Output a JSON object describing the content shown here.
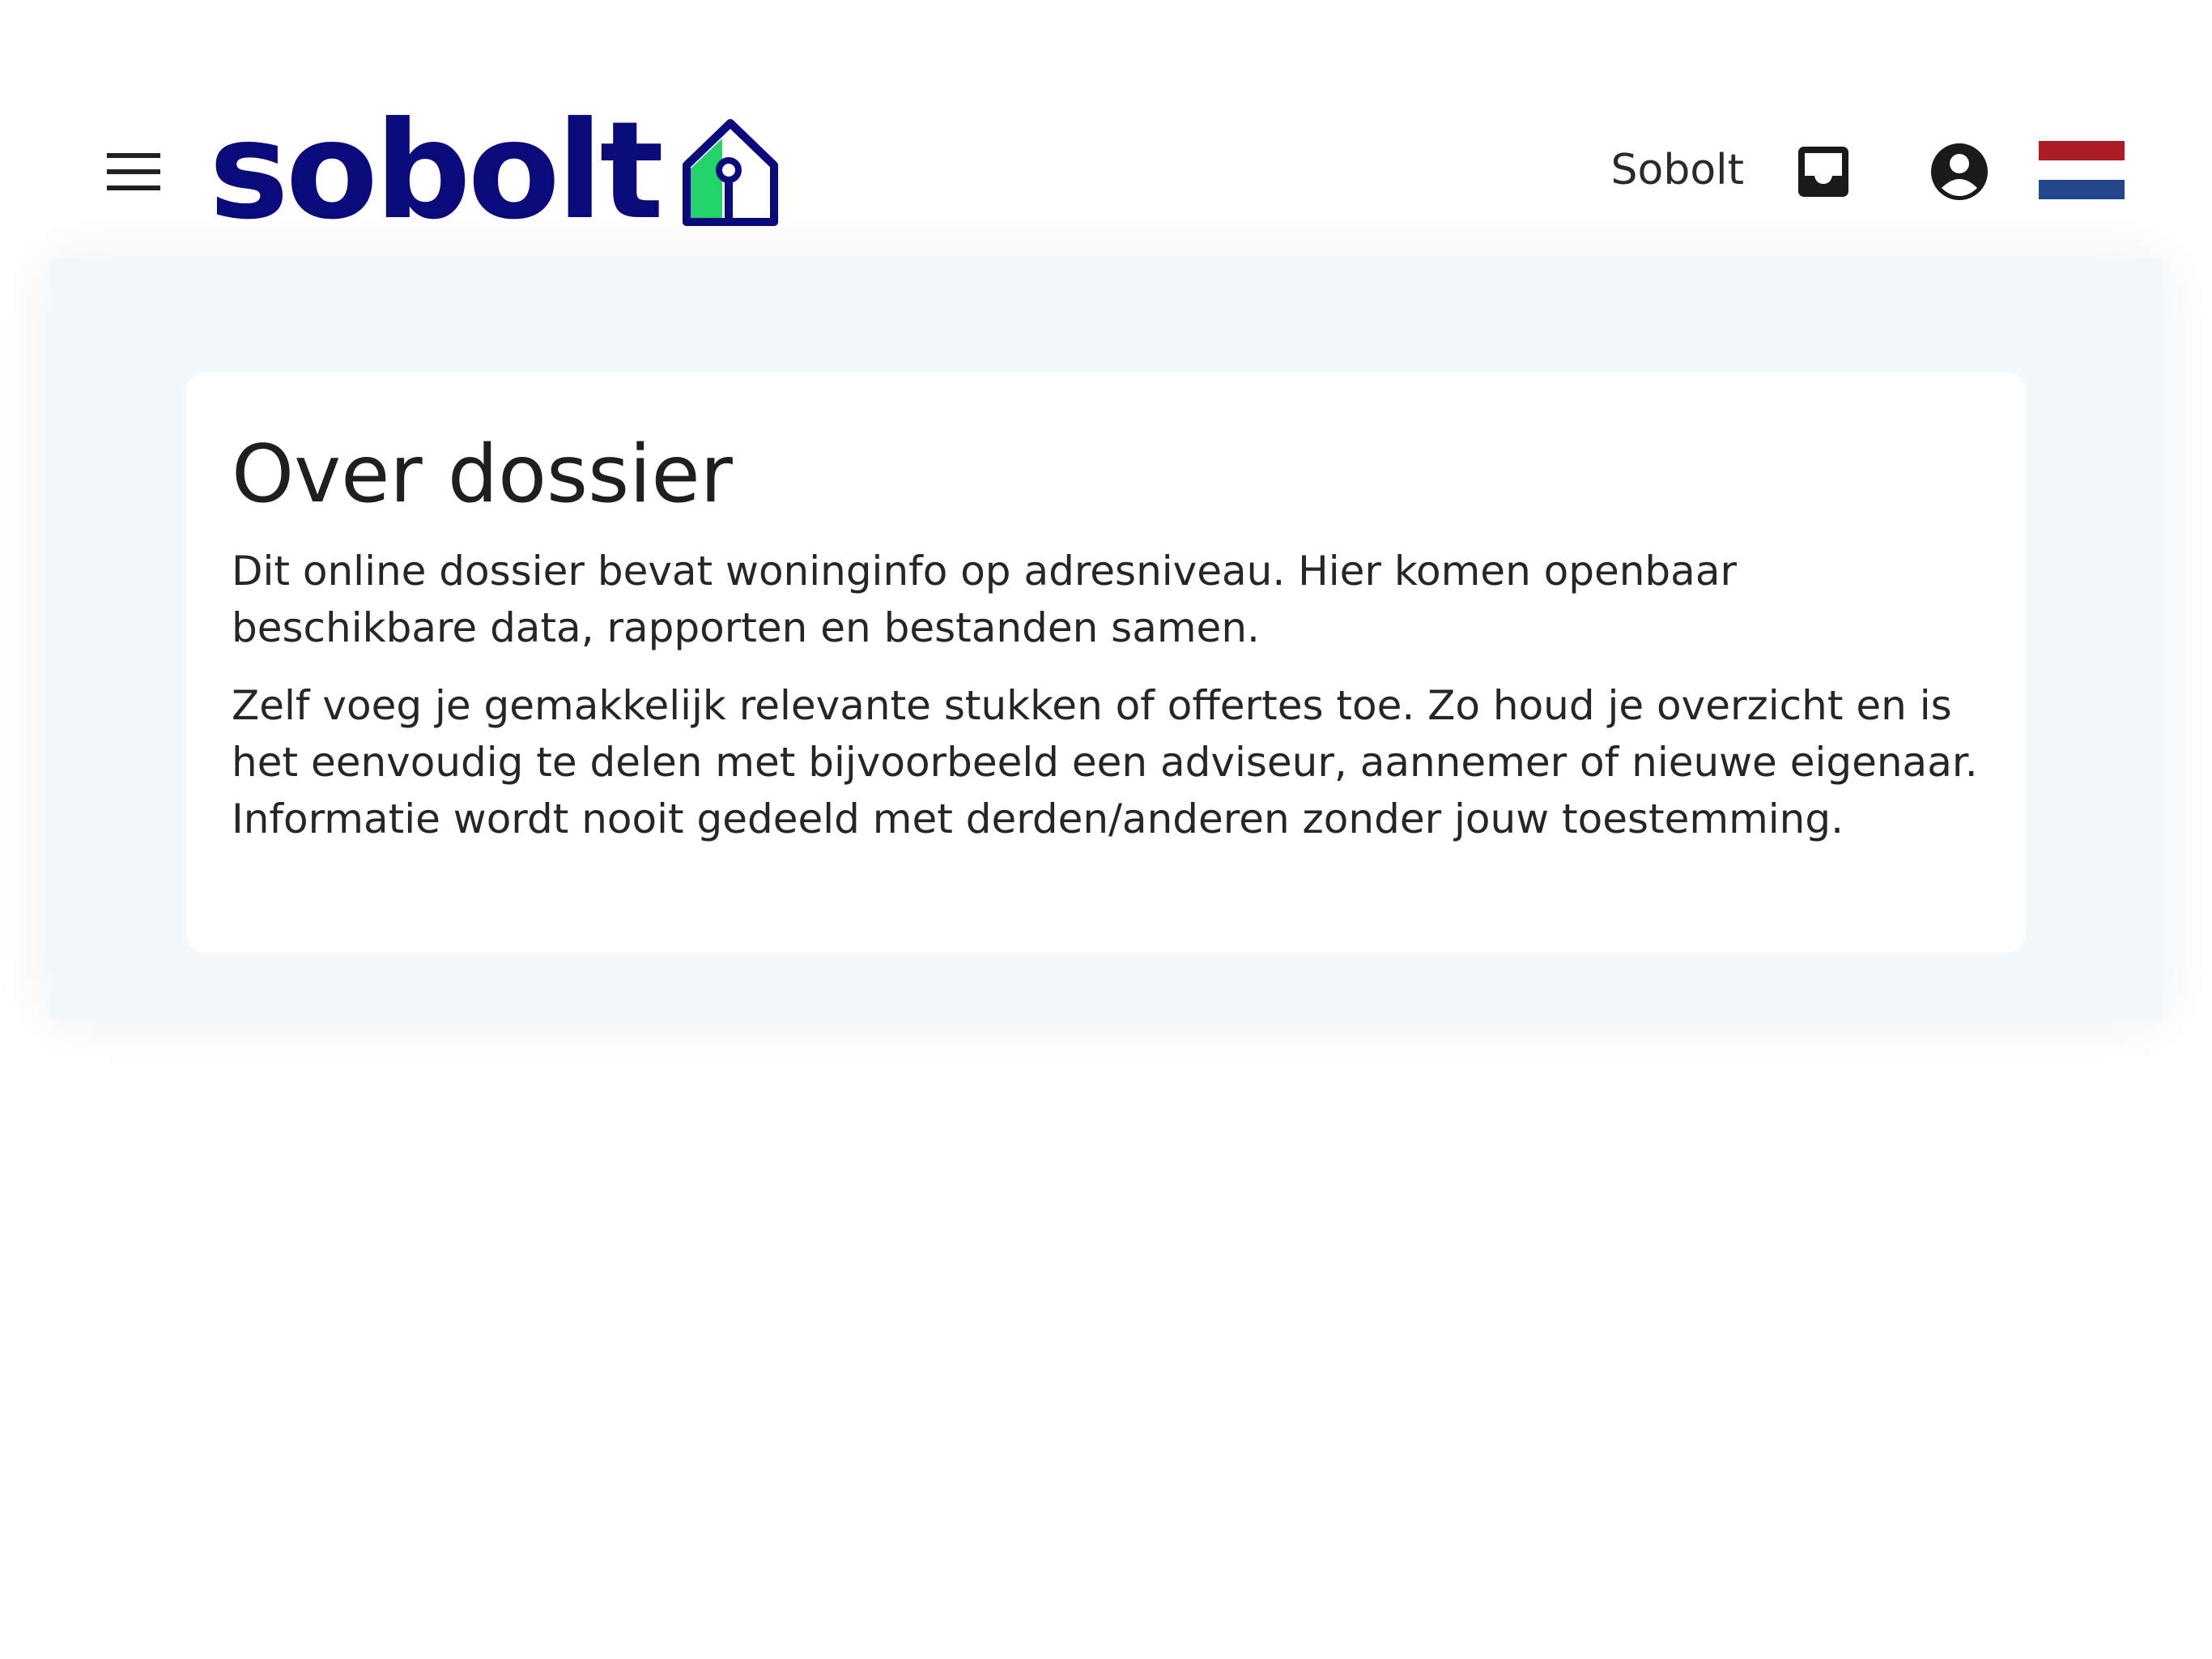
{
  "header": {
    "menu_icon": "hamburger-menu-icon",
    "logo_text": "sobolt",
    "logo_icon": "house-keyhole-icon",
    "account_name": "Sobolt",
    "inbox_icon": "inbox-icon",
    "account_icon": "account-circle-icon",
    "language_flag_icon": "netherlands-flag-icon"
  },
  "colors": {
    "brand_navy": "#0b0a7c",
    "brand_green": "#22d46a",
    "panel_background": "#f3f8fc",
    "flag_red": "#ae1c28",
    "flag_white": "#ffffff",
    "flag_blue": "#21468b"
  },
  "info_card": {
    "title": "Over dossier",
    "paragraph_1": "Dit online dossier bevat woninginfo op adresniveau. Hier komen openbaar beschikbare data, rapporten en bestanden samen.",
    "paragraph_2": "Zelf voeg je gemakkelijk relevante stukken of offertes toe. Zo houd je overzicht en is het eenvoudig te delen met bijvoorbeeld een adviseur, aannemer of nieuwe eigenaar. Informatie wordt nooit gedeeld met derden/anderen zonder jouw toestemming."
  }
}
